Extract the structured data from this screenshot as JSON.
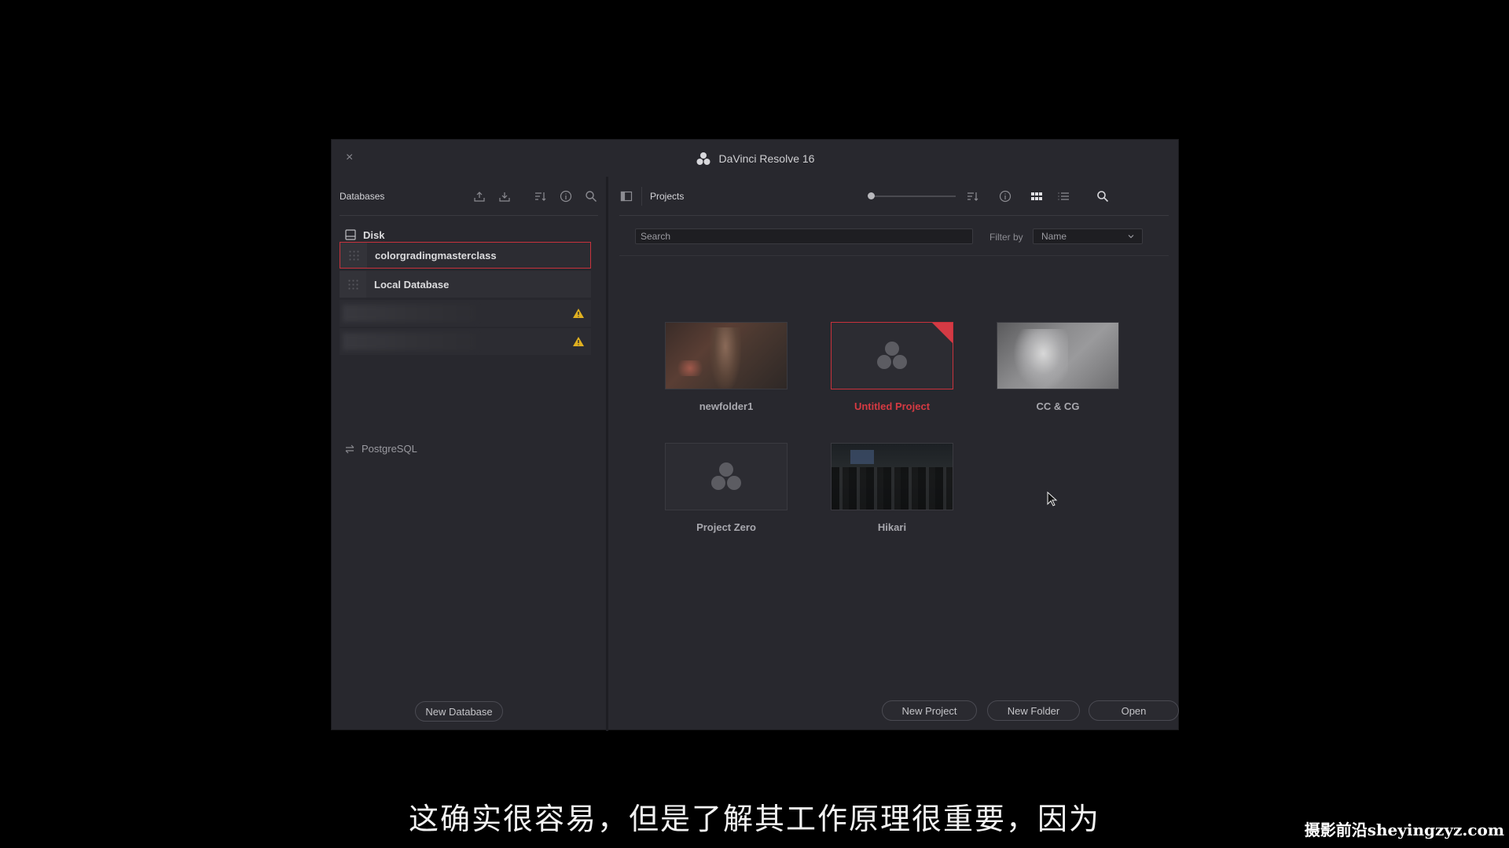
{
  "window": {
    "title": "DaVinci Resolve 16",
    "close_glyph": "×"
  },
  "databases": {
    "panel_title": "Databases",
    "disk_label": "Disk",
    "items": [
      {
        "name": "colorgradingmasterclass",
        "selected": true
      },
      {
        "name": "Local Database",
        "selected": false
      }
    ],
    "blurred_items": 2,
    "postgres_label": "PostgreSQL",
    "new_database_label": "New Database",
    "icons": [
      "upload-icon",
      "download-icon",
      "sort-icon",
      "info-icon",
      "search-icon"
    ]
  },
  "projects": {
    "panel_title": "Projects",
    "search_placeholder": "Search",
    "filter_label": "Filter by",
    "filter_value": "Name",
    "tiles": [
      {
        "name": "newfolder1",
        "type": "folder",
        "folder_count": "1",
        "selected": false
      },
      {
        "name": "Untitled Project",
        "type": "empty",
        "selected": true
      },
      {
        "name": "CC & CG",
        "type": "image",
        "selected": false
      },
      {
        "name": "Project Zero",
        "type": "empty",
        "selected": false
      },
      {
        "name": "Hikari",
        "type": "image",
        "selected": false
      }
    ],
    "buttons": {
      "new_project": "New Project",
      "new_folder": "New Folder",
      "open": "Open"
    },
    "icons": [
      "sidebar-toggle-icon",
      "sort-icon",
      "info-icon",
      "grid-view-icon",
      "list-view-icon",
      "search-icon"
    ]
  },
  "overlay": {
    "subtitle": "这确实很容易，但是了解其工作原理很重要，因为",
    "watermark": "摄影前沿sheyingzyz.com"
  },
  "colors": {
    "accent_red": "#d43a44",
    "panel_bg": "#28282e",
    "warning_yellow": "#e0b020"
  }
}
